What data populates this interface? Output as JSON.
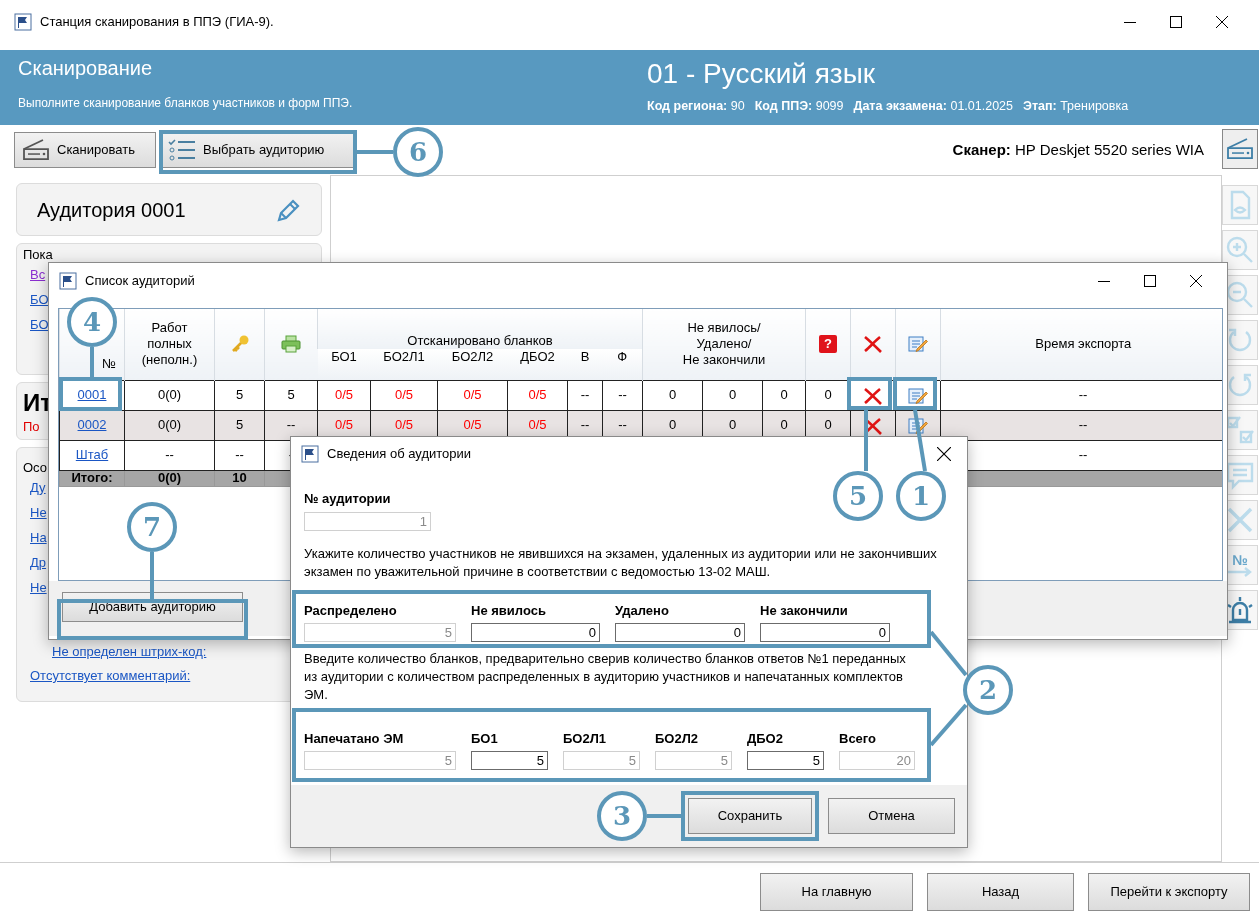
{
  "window": {
    "title": "Станция сканирования в ППЭ (ГИА-9)."
  },
  "header": {
    "title": "Сканирование",
    "subtitle": "Выполните сканирование бланков участников и форм ППЭ.",
    "subject": "01 - Русский язык",
    "info": [
      {
        "label": "Код региона:",
        "value": "90"
      },
      {
        "label": "Код ППЭ:",
        "value": "9099"
      },
      {
        "label": "Дата экзамена:",
        "value": "01.01.2025"
      },
      {
        "label": "Этап:",
        "value": "Тренировка"
      }
    ]
  },
  "toolbar": {
    "buttons": [
      {
        "kind": "scan",
        "label": "Сканировать"
      },
      {
        "kind": "list",
        "label": "Выбрать аудиторию"
      }
    ],
    "scanner_label": "Сканер:",
    "scanner_value": "HP Deskjet 5520 series WIA"
  },
  "left_panel": {
    "room_title": "Аудитория 0001",
    "sections": [
      {
        "kind": "links",
        "heading": "Пока",
        "links": [
          {
            "text": "Вс",
            "visited": true,
            "indented": false
          },
          {
            "text": "БО",
            "visited": false,
            "indented": false
          },
          {
            "text": "БО",
            "visited": false,
            "indented": false
          }
        ]
      },
      {
        "kind": "summary",
        "heading": "Ит",
        "note": "По"
      },
      {
        "kind": "links",
        "heading": "Осо",
        "links": [
          {
            "text": "Ду",
            "visited": false,
            "indented": false
          },
          {
            "text": "Не",
            "visited": false,
            "indented": false
          },
          {
            "text": "На",
            "visited": false,
            "indented": false
          },
          {
            "text": "Др",
            "visited": false,
            "indented": false
          },
          {
            "text": "Не",
            "visited": false,
            "indented": false
          },
          {
            "text": "Не определен штрих-код:",
            "visited": false,
            "indented": true
          },
          {
            "text": "Отсутствует комментарий:",
            "visited": false,
            "indented": false
          }
        ]
      }
    ]
  },
  "right_toolbar": [
    {
      "kind": "scanner",
      "disabled": false
    },
    {
      "kind": "document",
      "disabled": true
    },
    {
      "kind": "zoom-in",
      "disabled": true
    },
    {
      "kind": "zoom-out",
      "disabled": true
    },
    {
      "kind": "rotate-left",
      "disabled": true
    },
    {
      "kind": "rotate-right",
      "disabled": true
    },
    {
      "kind": "checks",
      "disabled": true
    },
    {
      "kind": "comment",
      "disabled": true
    },
    {
      "kind": "cross",
      "disabled": true
    },
    {
      "kind": "number",
      "label": "№",
      "disabled": true
    },
    {
      "kind": "alarm",
      "disabled": false
    }
  ],
  "rooms_dialog": {
    "title": "Список аудиторий",
    "columns": [
      {
        "kind": "text",
        "lines": [
          "№"
        ]
      },
      {
        "kind": "text",
        "lines": [
          "Работ",
          "полных",
          "(неполн.)"
        ]
      },
      {
        "kind": "key"
      },
      {
        "kind": "printer"
      },
      {
        "kind": "group",
        "label": "Отсканировано бланков",
        "subcolumns": [
          "БО1",
          "БО2Л1",
          "БО2Л2",
          "ДБО2",
          "В",
          "Ф"
        ]
      },
      {
        "kind": "wide",
        "lines": [
          "Не явилось/",
          "Удалено/",
          "Не закончили"
        ]
      },
      {
        "kind": "help",
        "label": "?"
      },
      {
        "kind": "delete"
      },
      {
        "kind": "edit"
      },
      {
        "kind": "text",
        "lines": [
          "Время экспорта"
        ]
      }
    ],
    "rows": [
      {
        "number": "0001",
        "selected": false,
        "works": "0(0)",
        "keys": "5",
        "printed": "5",
        "scanned": [
          {
            "text": "0/5",
            "alert": true
          },
          {
            "text": "0/5",
            "alert": true
          },
          {
            "text": "0/5",
            "alert": true
          },
          {
            "text": "0/5",
            "alert": true
          },
          {
            "text": "--",
            "alert": false
          },
          {
            "text": "--",
            "alert": false
          }
        ],
        "absent": [
          "0",
          "0",
          "0"
        ],
        "errors": "0",
        "actions": true,
        "export_time": "--"
      },
      {
        "number": "0002",
        "selected": true,
        "works": "0(0)",
        "keys": "5",
        "printed": "--",
        "scanned": [
          {
            "text": "0/5",
            "alert": true
          },
          {
            "text": "0/5",
            "alert": true
          },
          {
            "text": "0/5",
            "alert": true
          },
          {
            "text": "0/5",
            "alert": true
          },
          {
            "text": "--",
            "alert": false
          },
          {
            "text": "--",
            "alert": false
          }
        ],
        "absent": [
          "0",
          "0",
          "0"
        ],
        "errors": "0",
        "actions": true,
        "export_time": "--"
      },
      {
        "number": "Штаб",
        "selected": false,
        "works": "--",
        "keys": "--",
        "printed": "-",
        "export_time": "--"
      }
    ],
    "total": {
      "label": "Итого:",
      "works": "0(0)",
      "keys": "10"
    },
    "add_button": "Добавить аудиторию"
  },
  "room_dialog": {
    "title": "Сведения об аудитории",
    "number_label": "№ аудитории",
    "number_field": {
      "value": "1",
      "disabled": true
    },
    "note_1": "Укажите количество участников не явившихся на экзамен, удаленных из аудитории или не закончивших экзамен по уважительной причине в соответствии с ведомостью 13-02 МАШ.",
    "counts": [
      {
        "label": "Распределено",
        "value": "5",
        "disabled": true
      },
      {
        "label": "Не явилось",
        "value": "0",
        "disabled": false
      },
      {
        "label": "Удалено",
        "value": "0",
        "disabled": false
      },
      {
        "label": "Не закончили",
        "value": "0",
        "disabled": false
      }
    ],
    "note_2": "Введите количество бланков, предварительно сверив количество бланков ответов №1 переданных из аудитории с количеством распределенных в аудиторию участников и напечатанных комплектов ЭМ.",
    "forms": [
      {
        "label": "Напечатано ЭМ",
        "value": "5",
        "disabled": true
      },
      {
        "label": "БО1",
        "value": "5",
        "disabled": false
      },
      {
        "label": "БО2Л1",
        "value": "5",
        "disabled": true
      },
      {
        "label": "БО2Л2",
        "value": "5",
        "disabled": true
      },
      {
        "label": "ДБО2",
        "value": "5",
        "disabled": false
      },
      {
        "label": "Всего",
        "value": "20",
        "disabled": true
      }
    ],
    "buttons": [
      "Сохранить",
      "Отмена"
    ]
  },
  "footer": {
    "buttons": [
      "На главную",
      "Назад",
      "Перейти к экспорту"
    ]
  },
  "callouts": [
    {
      "number": "6"
    },
    {
      "number": "4"
    },
    {
      "number": "5"
    },
    {
      "number": "1"
    },
    {
      "number": "7"
    },
    {
      "number": "2"
    },
    {
      "number": "3"
    }
  ]
}
